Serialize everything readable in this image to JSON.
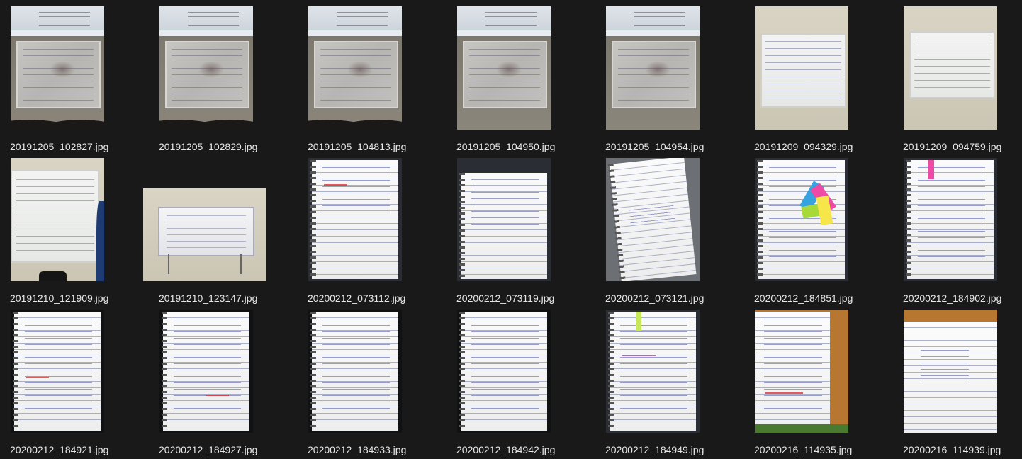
{
  "files": [
    {
      "name": "20191205_102827.jpg",
      "thumb": "classroom"
    },
    {
      "name": "20191205_102829.jpg",
      "thumb": "classroom"
    },
    {
      "name": "20191205_104813.jpg",
      "thumb": "classroom"
    },
    {
      "name": "20191205_104950.jpg",
      "thumb": "classroom-nohead"
    },
    {
      "name": "20191205_104954.jpg",
      "thumb": "classroom-nohead"
    },
    {
      "name": "20191209_094329.jpg",
      "thumb": "whiteboard"
    },
    {
      "name": "20191209_094759.jpg",
      "thumb": "whiteboard"
    },
    {
      "name": "20191210_121909.jpg",
      "thumb": "whiteboard-person"
    },
    {
      "name": "20191210_123147.jpg",
      "thumb": "easel"
    },
    {
      "name": "20200212_073112.jpg",
      "thumb": "notebook"
    },
    {
      "name": "20200212_073119.jpg",
      "thumb": "notebook"
    },
    {
      "name": "20200212_073121.jpg",
      "thumb": "notebook-tilt"
    },
    {
      "name": "20200212_184851.jpg",
      "thumb": "notebook-sticky"
    },
    {
      "name": "20200212_184902.jpg",
      "thumb": "notebook-bookmark"
    },
    {
      "name": "20200212_184921.jpg",
      "thumb": "notebook-dark"
    },
    {
      "name": "20200212_184927.jpg",
      "thumb": "notebook-dark"
    },
    {
      "name": "20200212_184933.jpg",
      "thumb": "notebook-dark"
    },
    {
      "name": "20200212_184942.jpg",
      "thumb": "notebook-dark"
    },
    {
      "name": "20200212_184949.jpg",
      "thumb": "notebook-bookmark"
    },
    {
      "name": "20200216_114935.jpg",
      "thumb": "notebook-warm"
    },
    {
      "name": "20200216_114939.jpg",
      "thumb": "notebook-warm"
    }
  ]
}
